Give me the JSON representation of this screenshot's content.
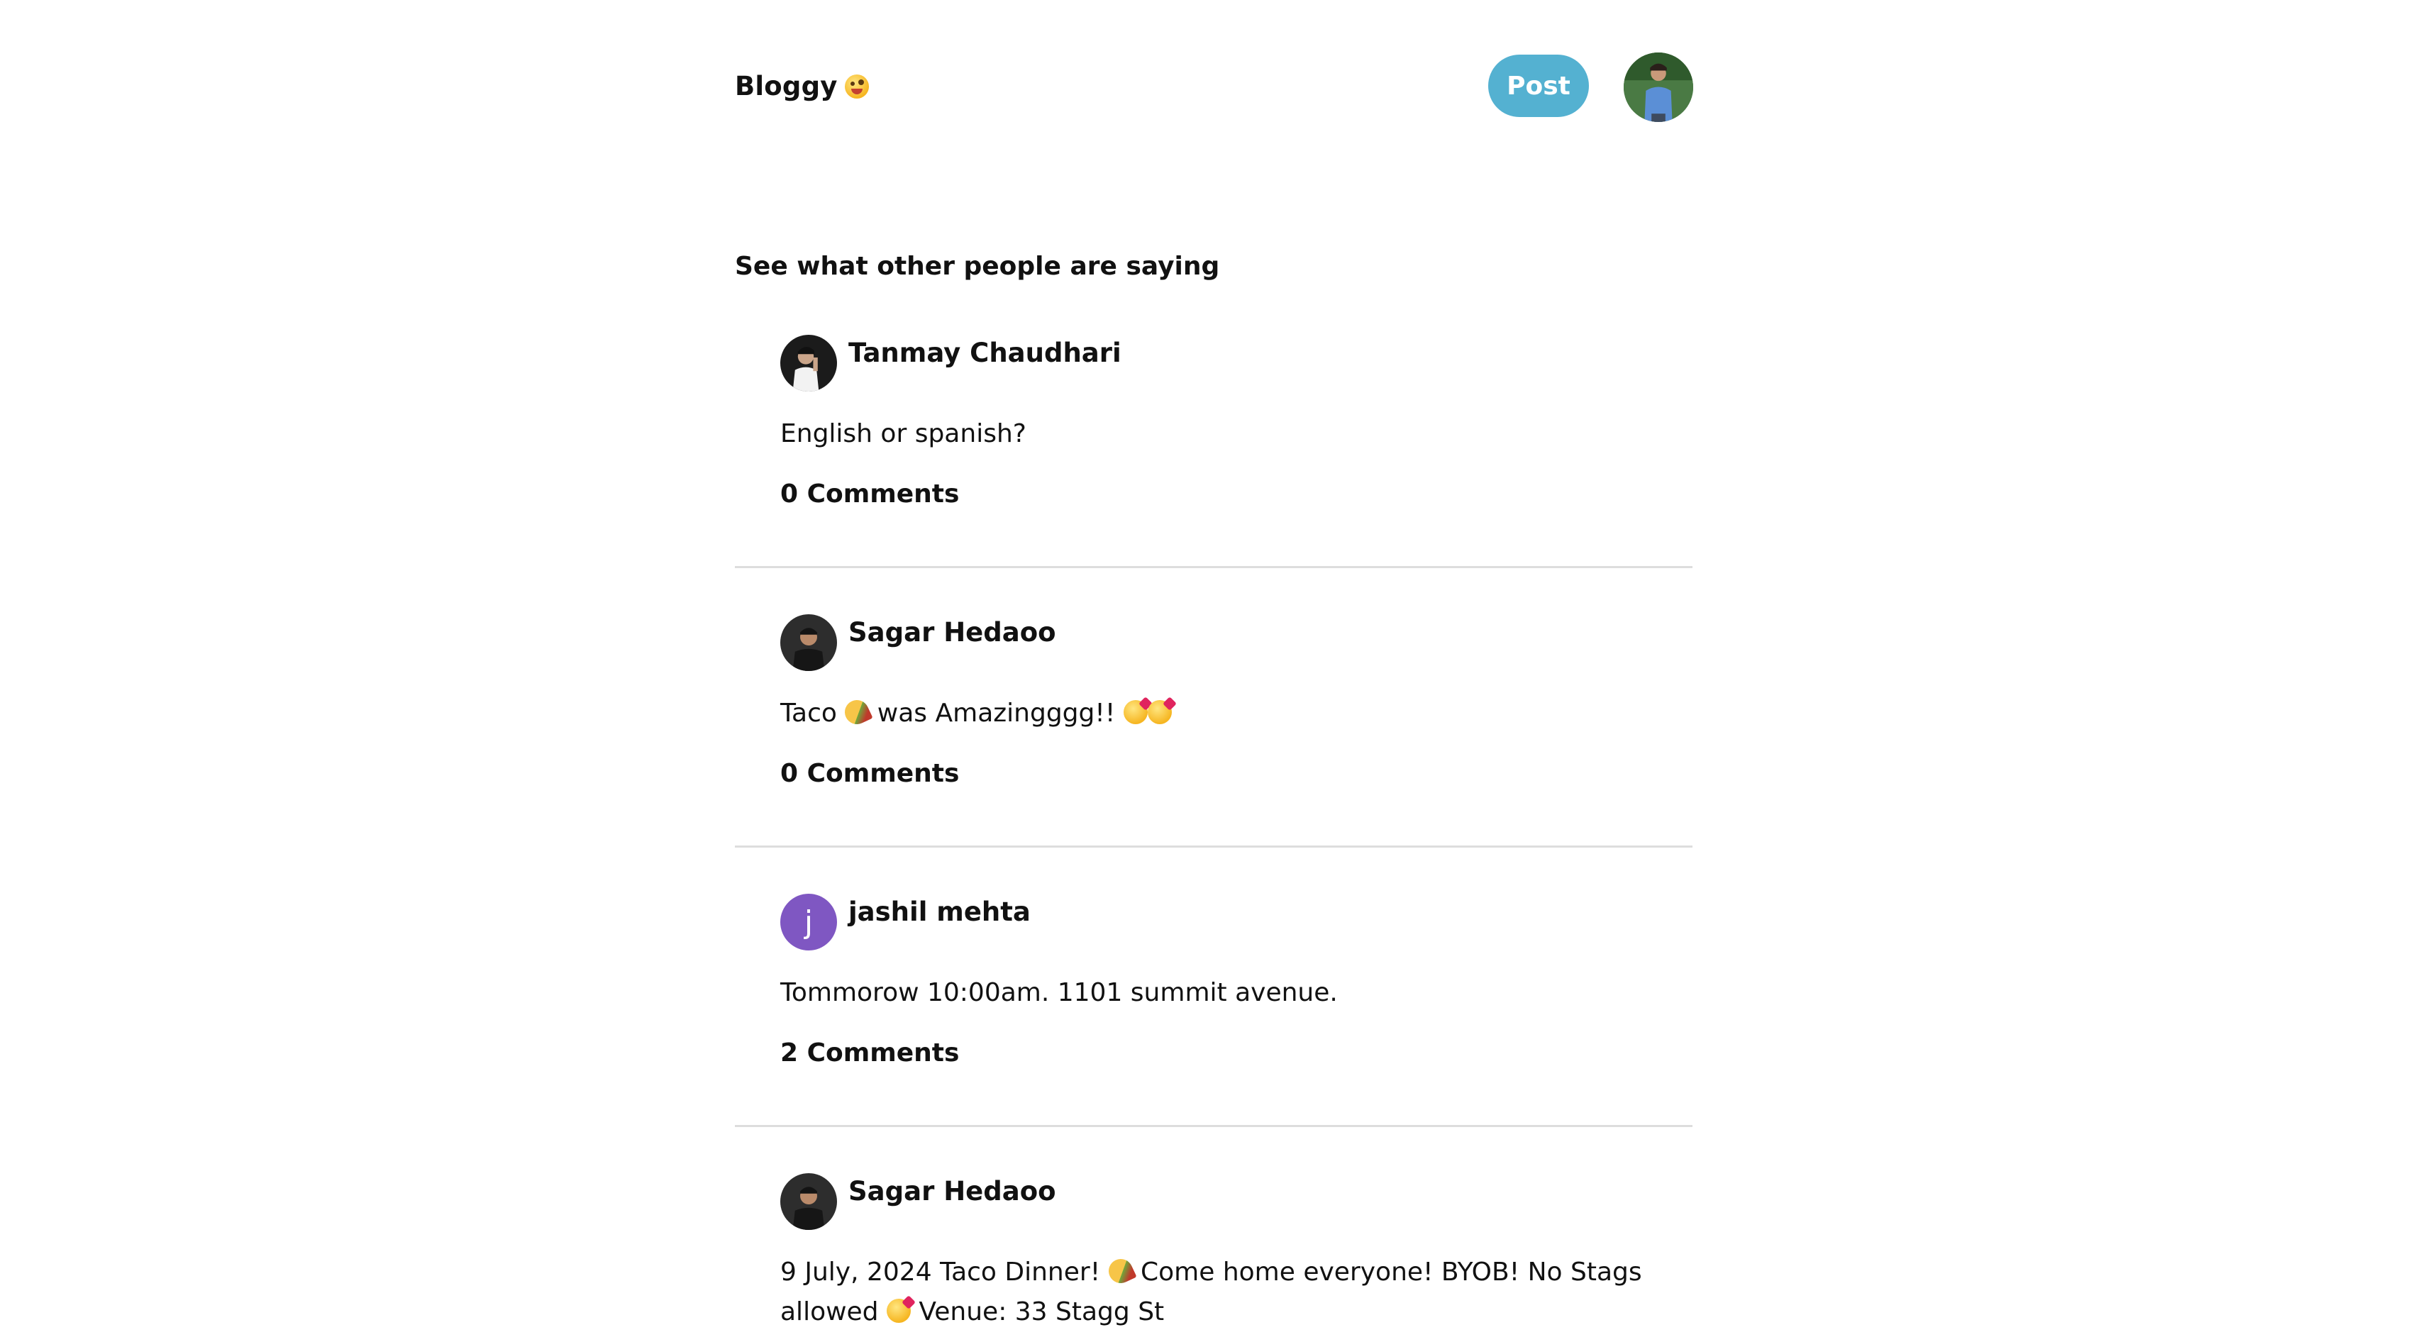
{
  "header": {
    "brand": "Bloggy",
    "brand_emoji": "zany-face-emoji",
    "post_button_label": "Post",
    "accent_color": "#54b1d1"
  },
  "feed": {
    "section_title": "See what other people are saying",
    "posts": [
      {
        "author": "Tanmay Chaudhari",
        "avatar_type": "photo",
        "body": "English or spanish?",
        "comments_label": "0 Comments"
      },
      {
        "author": "Sagar Hedaoo",
        "avatar_type": "photo",
        "body_parts": [
          "Taco ",
          " was Amazingggg!! "
        ],
        "comments_label": "0 Comments"
      },
      {
        "author": "jashil mehta",
        "avatar_type": "letter",
        "avatar_letter": "j",
        "avatar_color": "#7f57c2",
        "body": "Tommorow 10:00am. 1101 summit avenue.",
        "comments_label": "2 Comments"
      },
      {
        "author": "Sagar Hedaoo",
        "avatar_type": "photo",
        "body_parts": [
          "9 July, 2024 Taco Dinner! ",
          " Come home everyone! BYOB! No Stags allowed ",
          " Venue: 33 Stagg St"
        ]
      }
    ]
  }
}
